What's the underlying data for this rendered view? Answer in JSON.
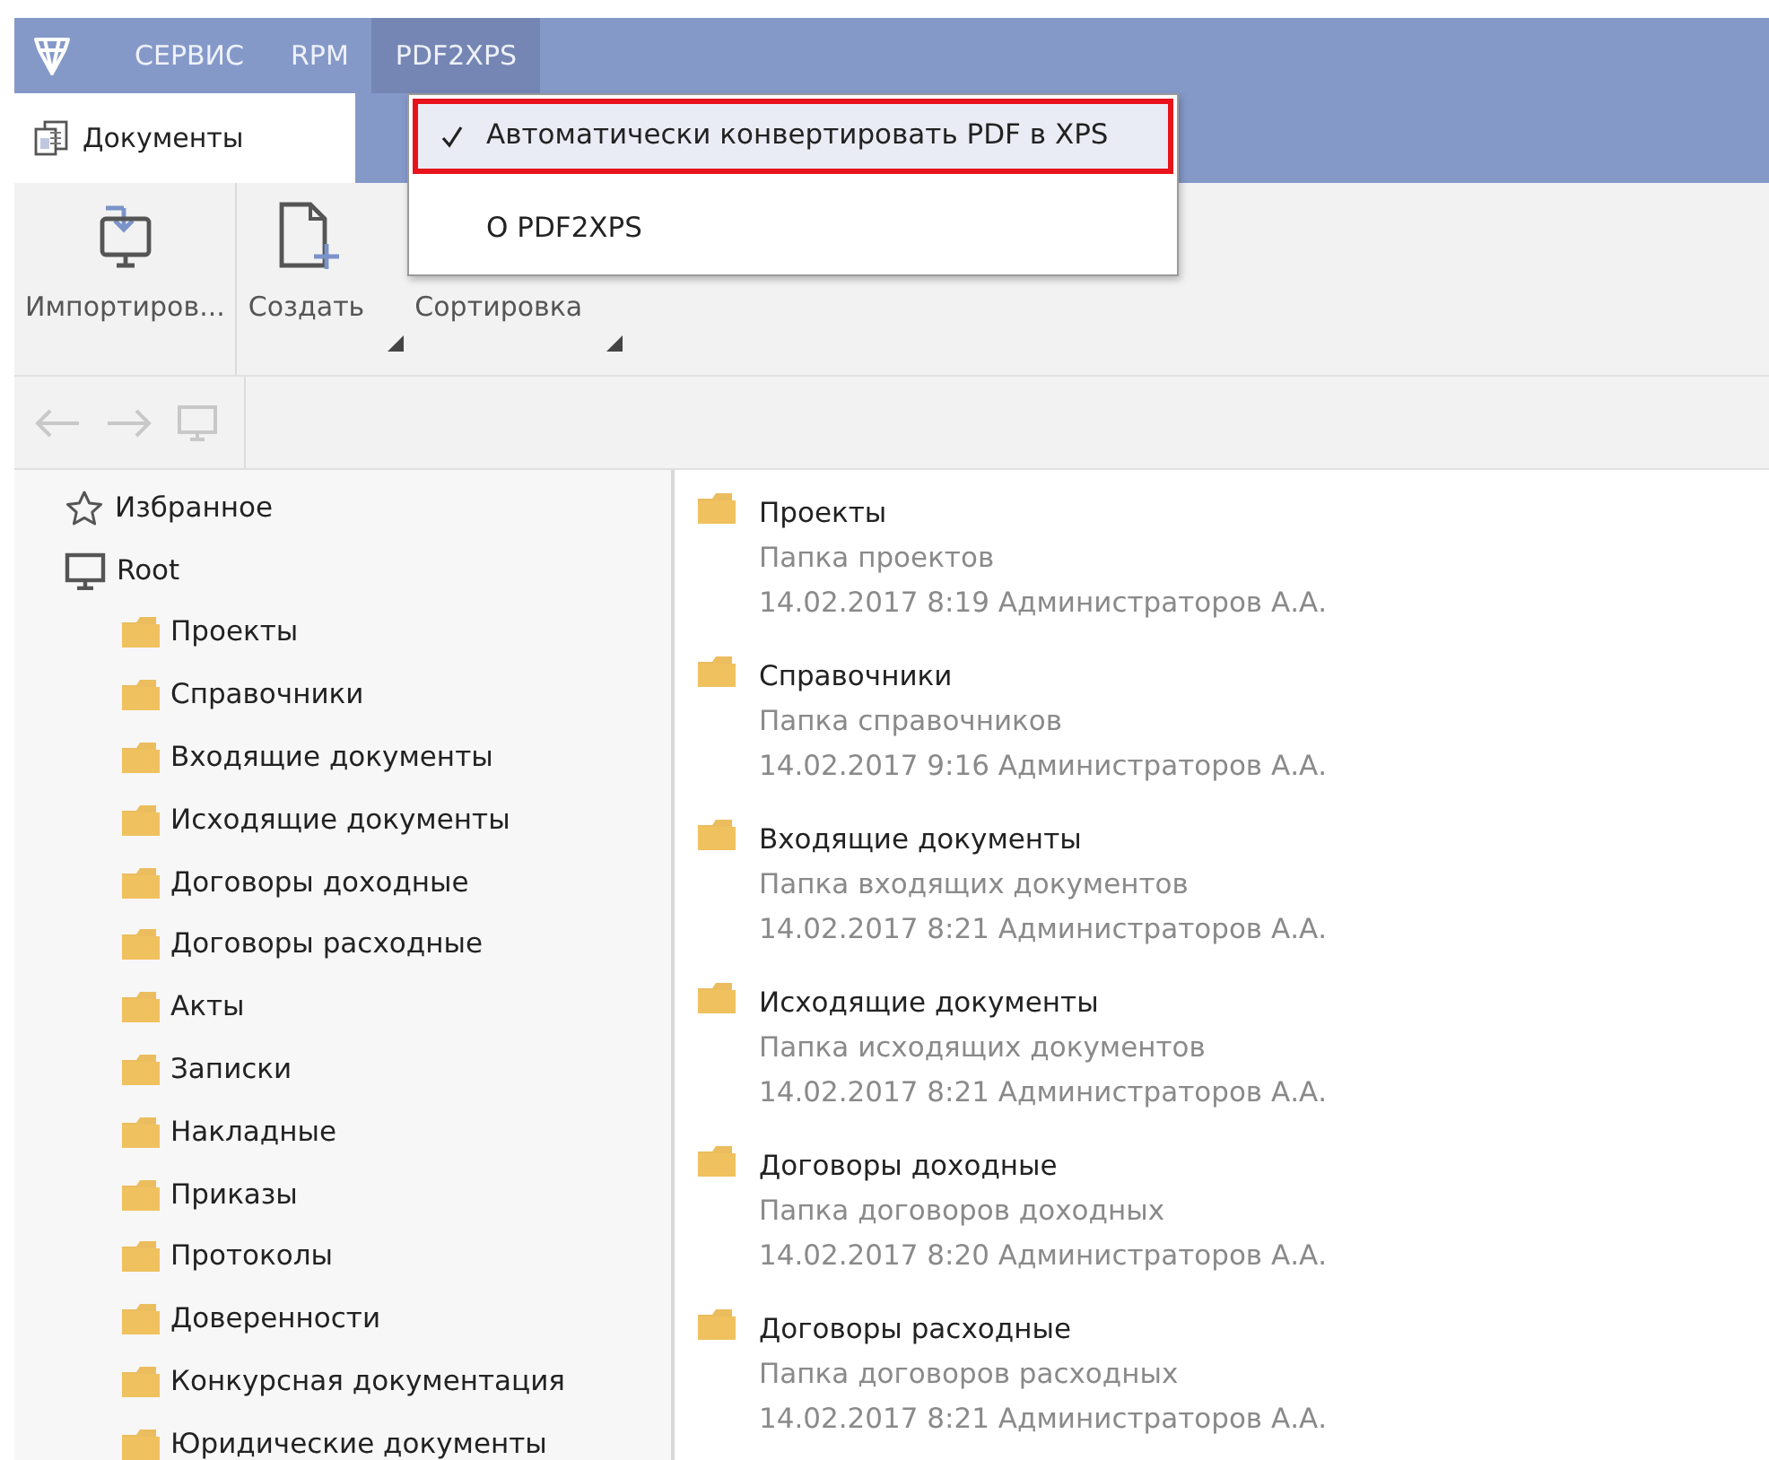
{
  "menu_bar": {
    "items": [
      {
        "label": "СЕРВИС",
        "selected": false
      },
      {
        "label": "RPM",
        "selected": false
      },
      {
        "label": "PDF2XPS",
        "selected": true
      }
    ]
  },
  "dropdown": {
    "items": [
      {
        "label": "Автоматически конвертировать PDF в XPS",
        "checked": true,
        "highlighted": true
      },
      {
        "label": "О PDF2XPS",
        "checked": false,
        "highlighted": false
      }
    ]
  },
  "tab": {
    "label": "Документы"
  },
  "toolbar": {
    "buttons": [
      {
        "label": "Импортиров...",
        "kind": "import",
        "dropdown": false
      },
      {
        "label": "Создать",
        "kind": "create",
        "dropdown": true
      },
      {
        "label": "Сортировка",
        "kind": "sort",
        "dropdown": true
      }
    ]
  },
  "tree": [
    {
      "label": "Избранное",
      "kind": "favorites"
    },
    {
      "label": "Root",
      "kind": "computer",
      "children": [
        {
          "label": "Проекты",
          "kind": "folder"
        },
        {
          "label": "Справочники",
          "kind": "folder"
        },
        {
          "label": "Входящие документы",
          "kind": "folder"
        },
        {
          "label": "Исходящие документы",
          "kind": "folder"
        },
        {
          "label": "Договоры доходные",
          "kind": "folder"
        },
        {
          "label": "Договоры расходные",
          "kind": "folder"
        },
        {
          "label": "Акты",
          "kind": "folder"
        },
        {
          "label": "Записки",
          "kind": "folder"
        },
        {
          "label": "Накладные",
          "kind": "folder"
        },
        {
          "label": "Приказы",
          "kind": "folder"
        },
        {
          "label": "Протоколы",
          "kind": "folder"
        },
        {
          "label": "Доверенности",
          "kind": "folder"
        },
        {
          "label": "Конкурсная документация",
          "kind": "folder"
        },
        {
          "label": "Юридические документы",
          "kind": "folder"
        }
      ]
    }
  ],
  "documents": [
    {
      "title": "Проекты",
      "description": "Папка проектов",
      "meta": "14.02.2017 8:19 Администраторов А.А."
    },
    {
      "title": "Справочники",
      "description": "Папка справочников",
      "meta": "14.02.2017 9:16 Администраторов А.А."
    },
    {
      "title": "Входящие документы",
      "description": "Папка входящих документов",
      "meta": "14.02.2017 8:21 Администраторов А.А."
    },
    {
      "title": "Исходящие документы",
      "description": "Папка исходящих документов",
      "meta": "14.02.2017 8:21 Администраторов А.А."
    },
    {
      "title": "Договоры доходные",
      "description": "Папка договоров доходных",
      "meta": "14.02.2017 8:20 Администраторов А.А."
    },
    {
      "title": "Договоры расходные",
      "description": "Папка договоров расходных",
      "meta": "14.02.2017 8:21 Администраторов А.А."
    }
  ]
}
